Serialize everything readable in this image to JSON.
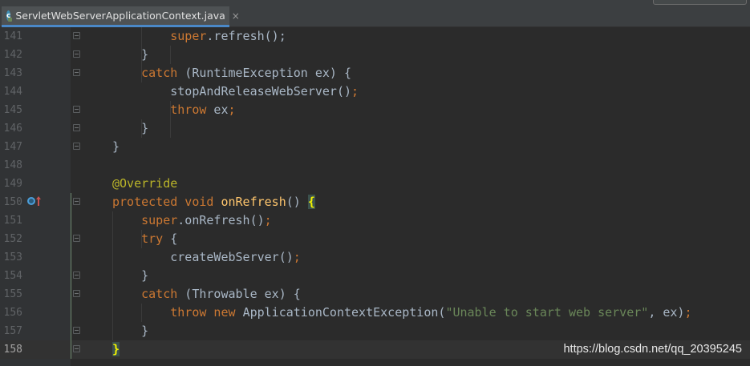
{
  "top_strip": {
    "breadcrumb": "",
    "search_box_value": ""
  },
  "tab": {
    "label": "ServletWebServerApplicationContext.java",
    "close_glyph": "×",
    "icon": "class-icon",
    "icon_letter": "c"
  },
  "lines": [
    {
      "n": "141",
      "tokens": [
        {
          "t": "        "
        },
        {
          "t": "super",
          "c": "kw"
        },
        {
          "t": ".refresh();"
        }
      ]
    },
    {
      "n": "142",
      "tokens": [
        {
          "t": "    }"
        }
      ]
    },
    {
      "n": "143",
      "tokens": [
        {
          "t": "    "
        },
        {
          "t": "catch",
          "c": "kw"
        },
        {
          "t": " (RuntimeException ex) {"
        }
      ]
    },
    {
      "n": "144",
      "tokens": [
        {
          "t": "        stopAndReleaseWebServer()"
        },
        {
          "t": ";",
          "c": "kw"
        }
      ]
    },
    {
      "n": "145",
      "tokens": [
        {
          "t": "        "
        },
        {
          "t": "throw",
          "c": "kw"
        },
        {
          "t": " ex"
        },
        {
          "t": ";",
          "c": "kw"
        }
      ]
    },
    {
      "n": "146",
      "tokens": [
        {
          "t": "    }"
        }
      ]
    },
    {
      "n": "147",
      "tokens": [
        {
          "t": "}"
        }
      ]
    },
    {
      "n": "148",
      "tokens": []
    },
    {
      "n": "149",
      "tokens": [
        {
          "t": "@Override",
          "c": "an"
        }
      ]
    },
    {
      "n": "150",
      "tokens": [
        {
          "t": "protected void ",
          "c": "kw"
        },
        {
          "t": "onRefresh",
          "c": "fn"
        },
        {
          "t": "() "
        },
        {
          "t": "{",
          "c": "match"
        }
      ]
    },
    {
      "n": "151",
      "tokens": [
        {
          "t": "    "
        },
        {
          "t": "super",
          "c": "kw"
        },
        {
          "t": ".onRefresh()"
        },
        {
          "t": ";",
          "c": "kw"
        }
      ]
    },
    {
      "n": "152",
      "tokens": [
        {
          "t": "    "
        },
        {
          "t": "try",
          "c": "kw"
        },
        {
          "t": " {"
        }
      ]
    },
    {
      "n": "153",
      "tokens": [
        {
          "t": "        createWebServer()"
        },
        {
          "t": ";",
          "c": "kw"
        }
      ]
    },
    {
      "n": "154",
      "tokens": [
        {
          "t": "    }"
        }
      ]
    },
    {
      "n": "155",
      "tokens": [
        {
          "t": "    "
        },
        {
          "t": "catch",
          "c": "kw"
        },
        {
          "t": " (Throwable ex) {"
        }
      ]
    },
    {
      "n": "156",
      "tokens": [
        {
          "t": "        "
        },
        {
          "t": "throw new ",
          "c": "kw"
        },
        {
          "t": "ApplicationContextException("
        },
        {
          "t": "\"Unable to start web server\"",
          "c": "str"
        },
        {
          "t": ", ex)"
        },
        {
          "t": ";",
          "c": "kw"
        }
      ]
    },
    {
      "n": "157",
      "tokens": [
        {
          "t": "    }"
        }
      ]
    },
    {
      "n": "158",
      "tokens": [
        {
          "t": "}",
          "c": "match"
        }
      ]
    }
  ],
  "current_line": "158",
  "fold_lines": [
    "141",
    "142",
    "143",
    "145",
    "146",
    "147",
    "150",
    "152",
    "154",
    "155",
    "157",
    "158"
  ],
  "gutter_marker_line": "150",
  "gutter_marker_icons": [
    "overrides-method-icon",
    "up-arrow-icon"
  ],
  "watermark": "https://blog.csdn.net/qq_20395245",
  "colors": {
    "background": "#2b2b2b",
    "gutter": "#313335",
    "keyword": "#cc7832",
    "method": "#ffc66d",
    "annotation": "#bbb529",
    "string": "#6a8759",
    "text": "#a9b7c6",
    "line_number": "#606366",
    "current_line": "#323232",
    "brace_match": "#f2f200"
  }
}
